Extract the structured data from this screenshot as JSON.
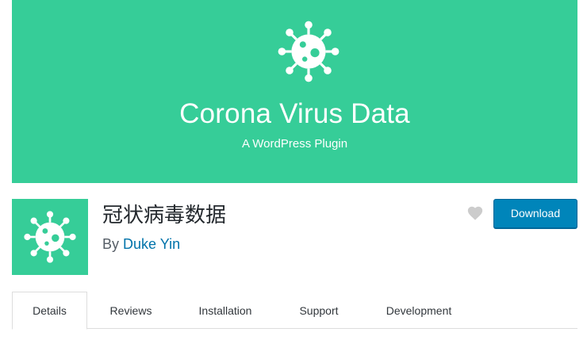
{
  "banner": {
    "title": "Corona Virus Data",
    "subtitle": "A WordPress Plugin",
    "icon": "virus-icon",
    "background_color": "#36cd98"
  },
  "plugin": {
    "name": "冠状病毒数据",
    "author_prefix": "By",
    "author_name": "Duke Yin",
    "icon": "virus-icon"
  },
  "actions": {
    "favorite_icon": "heart-icon",
    "download_label": "Download",
    "download_color": "#0085ba"
  },
  "tabs": [
    {
      "label": "Details",
      "active": true
    },
    {
      "label": "Reviews",
      "active": false
    },
    {
      "label": "Installation",
      "active": false
    },
    {
      "label": "Support",
      "active": false
    },
    {
      "label": "Development",
      "active": false
    }
  ]
}
